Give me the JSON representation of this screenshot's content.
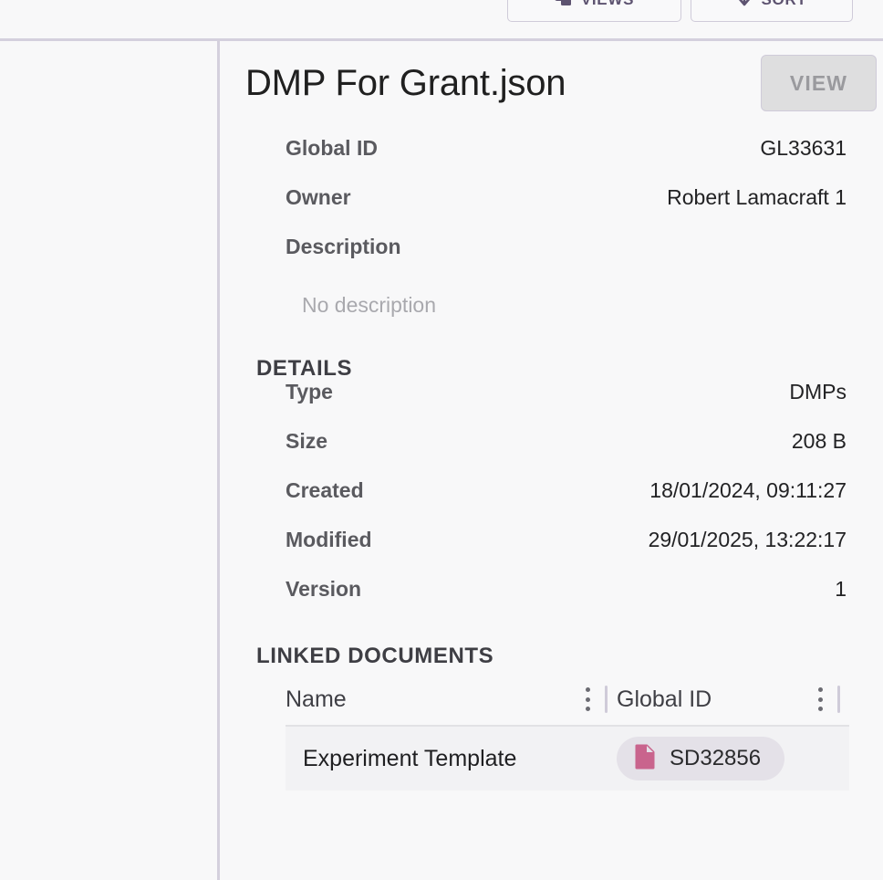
{
  "toolbar": {
    "buttons": [
      {
        "label": "VIEWS",
        "icon": "views-icon"
      },
      {
        "label": "SORT",
        "icon": "sort-down-arrow-icon"
      }
    ]
  },
  "detail": {
    "title": "DMP For Grant.json",
    "view_button": "VIEW",
    "summary": [
      {
        "key": "Global ID",
        "value": "GL33631"
      },
      {
        "key": "Owner",
        "value": "Robert Lamacraft 1"
      }
    ],
    "description_label": "Description",
    "description_value": "No description",
    "details_heading": "DETAILS",
    "details": [
      {
        "key": "Type",
        "value": "DMPs"
      },
      {
        "key": "Size",
        "value": "208 B"
      },
      {
        "key": "Created",
        "value": "18/01/2024, 09:11:27"
      },
      {
        "key": "Modified",
        "value": "29/01/2025, 13:22:17"
      },
      {
        "key": "Version",
        "value": "1"
      }
    ],
    "linked_heading": "LINKED DOCUMENTS",
    "linked_table": {
      "columns": [
        "Name",
        "Global ID"
      ],
      "rows": [
        {
          "name": "Experiment Template",
          "global_id": "SD32856",
          "icon": "document-file-icon"
        }
      ]
    }
  },
  "colors": {
    "page_background": "#f8f8f9",
    "divider": "#d4d0dd",
    "chip_background": "#e4e1e8",
    "chip_icon": "#c9648d",
    "row_background": "#f2f2f4",
    "toolbar_accent": "#5d5370"
  }
}
